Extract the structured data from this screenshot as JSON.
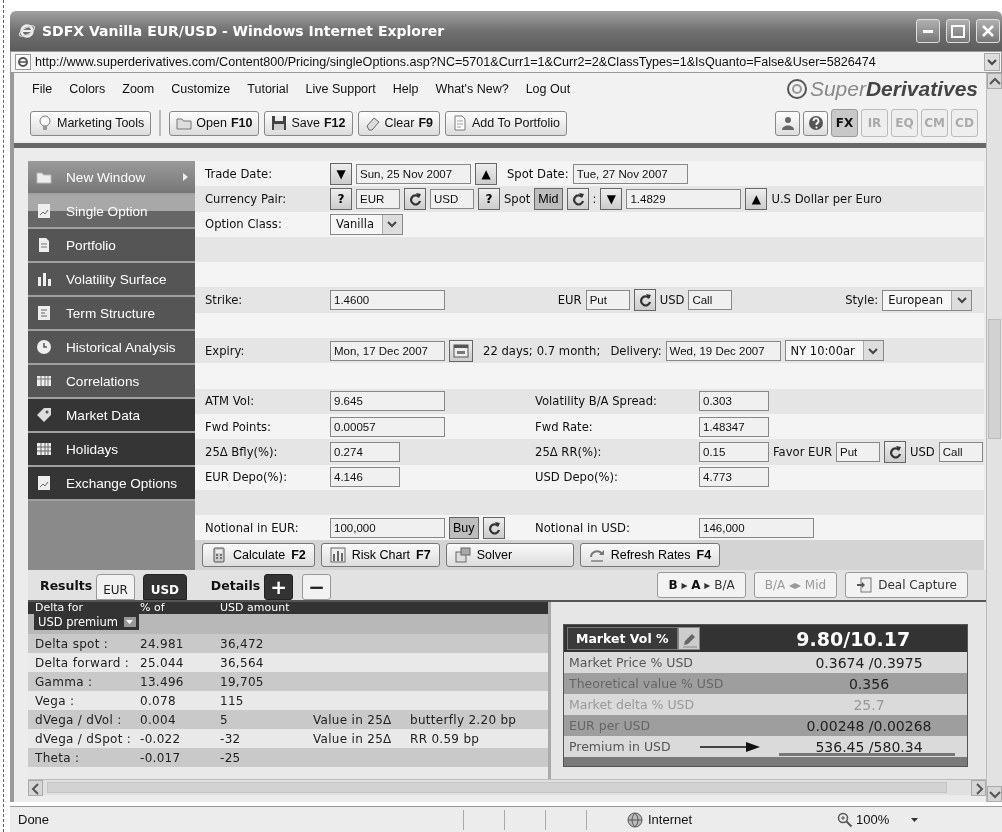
{
  "window": {
    "title": "SDFX Vanilla EUR/USD - Windows Internet Explorer"
  },
  "address_bar": {
    "url": "http://www.superderivatives.com/Content800/Pricing/singleOptions.asp?NC=5701&Curr1=1&Curr2=2&ClassTypes=1&IsQuanto=False&User=5826474"
  },
  "menu": [
    "File",
    "Colors",
    "Zoom",
    "Customize",
    "Tutorial",
    "Live Support",
    "Help",
    "What's New?",
    "Log Out"
  ],
  "logo": {
    "text": "Super**Derivatives**"
  },
  "toolbar": {
    "buttons": [
      {
        "label": "Marketing Tools"
      },
      {
        "label": "Open",
        "shortcut": "F10"
      },
      {
        "label": "Save",
        "shortcut": "F12"
      },
      {
        "label": "Clear",
        "shortcut": "F9"
      },
      {
        "label": "Add To Portfolio"
      }
    ],
    "asset_tabs": [
      {
        "label": "FX",
        "selected": true
      },
      {
        "label": "IR",
        "selected": false
      },
      {
        "label": "EQ",
        "selected": false
      },
      {
        "label": "CM",
        "selected": false
      },
      {
        "label": "CD",
        "selected": false
      }
    ]
  },
  "sidebar": {
    "items": [
      {
        "label": "New Window",
        "kind": "command",
        "selected": false
      },
      {
        "label": "Single Option",
        "kind": "page",
        "selected": true
      },
      {
        "label": "Portfolio",
        "kind": "page",
        "selected": false
      },
      {
        "label": "Volatility Surface",
        "kind": "page",
        "selected": false
      },
      {
        "label": "Term Structure",
        "kind": "page",
        "selected": false
      },
      {
        "label": "Historical Analysis",
        "kind": "page",
        "selected": false
      },
      {
        "label": "Correlations",
        "kind": "page",
        "selected": false
      },
      {
        "label": "Market Data",
        "kind": "data",
        "selected": false
      },
      {
        "label": "Holidays",
        "kind": "data",
        "selected": false
      },
      {
        "label": "Exchange Options",
        "kind": "data",
        "selected": false
      }
    ]
  },
  "form": {
    "rows": [
      {
        "label": "Trade Date:",
        "kind": "flow",
        "groups": [
          [
            {
              "kind": "button",
              "text": "▼"
            },
            {
              "kind": "field",
              "value": "Sun, 25 Nov 2007"
            },
            {
              "kind": "button",
              "text": "▲"
            }
          ],
          [
            {
              "kind": "text",
              "text": "Spot Date:"
            },
            {
              "kind": "field",
              "value": "Tue, 27 Nov 2007"
            }
          ]
        ]
      },
      {
        "label": "Currency Pair:",
        "kind": "flow",
        "groups": [
          [
            {
              "kind": "button",
              "text": "?"
            },
            {
              "kind": "code_field",
              "value": "EUR"
            },
            {
              "kind": "refresh_button"
            },
            {
              "kind": "code_field",
              "value": "USD"
            },
            {
              "kind": "button",
              "text": "?"
            },
            {
              "kind": "text",
              "text": "Spot"
            },
            {
              "kind": "toggle",
              "text": "Mid",
              "pressed": true
            },
            {
              "kind": "refresh_button"
            },
            {
              "kind": "text",
              "text": ":"
            },
            {
              "kind": "button",
              "text": "▼"
            },
            {
              "kind": "field",
              "value": "1.4829"
            },
            {
              "kind": "button",
              "text": "▲"
            },
            {
              "kind": "text",
              "text": "U.S Dollar per Euro"
            }
          ]
        ]
      },
      {
        "label": "Option Class:",
        "kind": "flow",
        "groups": [
          [
            {
              "kind": "select",
              "value": "Vanilla"
            }
          ]
        ]
      },
      {
        "kind": "flow",
        "groups": []
      },
      {
        "kind": "flow",
        "groups": []
      },
      {
        "label": "Strike:",
        "kind": "spread",
        "groups": [
          [
            {
              "kind": "field",
              "value": "1.4600"
            }
          ],
          [
            {
              "kind": "text",
              "text": "EUR"
            },
            {
              "kind": "code_field",
              "value": "Put"
            },
            {
              "kind": "refresh_button"
            },
            {
              "kind": "text",
              "text": "USD"
            },
            {
              "kind": "code_field",
              "value": "Call"
            }
          ],
          [
            {
              "kind": "text",
              "text": "Style:"
            },
            {
              "kind": "select",
              "value": "European"
            }
          ]
        ]
      },
      {
        "kind": "flow",
        "groups": []
      },
      {
        "label": "Expiry:",
        "kind": "flow",
        "groups": [
          [
            {
              "kind": "field",
              "value": "Mon, 17 Dec 2007"
            },
            {
              "kind": "calendar_button"
            }
          ],
          [
            {
              "kind": "text",
              "text": "22 days;"
            },
            {
              "kind": "text",
              "text": "0.7 month;"
            }
          ],
          [
            {
              "kind": "text",
              "text": "Delivery:"
            },
            {
              "kind": "field",
              "value": "Wed, 19 Dec 2007"
            },
            {
              "kind": "select",
              "value": "NY 10:00ar"
            }
          ]
        ]
      },
      {
        "kind": "flow",
        "groups": []
      },
      {
        "label": "ATM Vol:",
        "kind": "split",
        "groups": [
          [
            {
              "kind": "field",
              "value": "9.645"
            }
          ],
          [
            {
              "kind": "text",
              "text": "Volatility B/A Spread:"
            },
            {
              "kind": "short_field",
              "value": "0.303"
            }
          ]
        ]
      },
      {
        "label": "Fwd Points:",
        "kind": "split",
        "groups": [
          [
            {
              "kind": "field",
              "value": "0.00057"
            }
          ],
          [
            {
              "kind": "text",
              "text": "Fwd Rate:"
            },
            {
              "kind": "short_field",
              "value": "1.48347"
            }
          ]
        ]
      },
      {
        "label": "25Δ Bfly(%):",
        "kind": "split",
        "groups": [
          [
            {
              "kind": "short_field",
              "value": "0.274"
            }
          ],
          [
            {
              "kind": "text",
              "text": "25Δ RR(%):"
            },
            {
              "kind": "short_field",
              "value": "0.15"
            },
            {
              "kind": "text",
              "text": "Favor EUR"
            },
            {
              "kind": "code_field",
              "value": "Put"
            },
            {
              "kind": "refresh_button"
            },
            {
              "kind": "text",
              "text": "USD"
            },
            {
              "kind": "code_field",
              "value": "Call"
            }
          ]
        ]
      },
      {
        "label": "EUR Depo(%):",
        "kind": "split",
        "groups": [
          [
            {
              "kind": "short_field",
              "value": "4.146"
            }
          ],
          [
            {
              "kind": "text",
              "text": "USD Depo(%):"
            },
            {
              "kind": "short_field",
              "value": "4.773"
            }
          ]
        ]
      },
      {
        "kind": "flow",
        "groups": []
      },
      {
        "label": "Notional in EUR:",
        "kind": "split",
        "groups": [
          [
            {
              "kind": "field",
              "value": "100,000"
            },
            {
              "kind": "toggle",
              "text": "Buy",
              "pressed": true
            },
            {
              "kind": "refresh_button"
            }
          ],
          [
            {
              "kind": "text",
              "text": "Notional in USD:"
            },
            {
              "kind": "field",
              "value": "146,000"
            }
          ]
        ]
      }
    ]
  },
  "actions": [
    {
      "label": "Calculate",
      "shortcut": "F2"
    },
    {
      "label": "Risk Chart",
      "shortcut": "F7"
    },
    {
      "label": "Solver"
    },
    {
      "label": "Refresh Rates",
      "shortcut": "F4"
    }
  ],
  "results_bar": {
    "results_label": "Results",
    "currency_tabs": [
      {
        "label": "EUR",
        "selected": false
      },
      {
        "label": "USD",
        "selected": true
      }
    ],
    "details_label": "Details",
    "detail_buttons": [
      {
        "label": "+",
        "selected": true
      },
      {
        "label": "−",
        "selected": false
      }
    ],
    "view_buttons": [
      {
        "label": "**B** ▸ **A** ▸ B/A",
        "kind": "text",
        "disabled": false
      },
      {
        "label": "B/A ◂▸ Mid",
        "kind": "text",
        "disabled": true
      },
      {
        "label": "Deal Capture",
        "kind": "icon",
        "disabled": false
      }
    ]
  },
  "greeks": {
    "columns": [
      "Delta for",
      "% of",
      "USD amount"
    ],
    "premium_selector": "USD premium",
    "rows": [
      {
        "name": "Delta spot :",
        "percent": "24.981",
        "amount": "36,472"
      },
      {
        "name": "Delta forward :",
        "percent": "25.044",
        "amount": "36,564"
      },
      {
        "name": "Gamma :",
        "percent": "13.496",
        "amount": "19,705"
      },
      {
        "name": "Vega :",
        "percent": "0.078",
        "amount": "115"
      },
      {
        "name": "dVega / dVol :",
        "percent": "0.004",
        "amount": "5",
        "note_label": "Value in 25Δ",
        "note_value": "butterfly 2.20 bp"
      },
      {
        "name": "dVega / dSpot :",
        "percent": "-0.022",
        "amount": "-32",
        "note_label": "Value in 25Δ",
        "note_value": "RR 0.59 bp"
      },
      {
        "name": "Theta :",
        "percent": "-0.017",
        "amount": "-25"
      }
    ]
  },
  "market_panel": {
    "header": {
      "label": "Market Vol %",
      "value": "9.80/10.17"
    },
    "rows": [
      {
        "label": "Market Price % USD",
        "value": "0.3674 /0.3975",
        "kind": "plain",
        "muted": false
      },
      {
        "label": "Theoretical value % USD",
        "value": "0.356",
        "kind": "plain",
        "muted": false
      },
      {
        "label": "Market delta % USD",
        "value": "25.7",
        "kind": "plain",
        "muted": true
      },
      {
        "label": "EUR  per  USD",
        "value": "0.00248 /0.00268",
        "kind": "plain",
        "muted": false
      },
      {
        "label": "Premium in USD",
        "value": "536.45 /580.34",
        "kind": "arrowed",
        "muted": false
      }
    ]
  },
  "status_bar": {
    "text": "Done",
    "zone": "Internet",
    "zoom": "100%"
  }
}
